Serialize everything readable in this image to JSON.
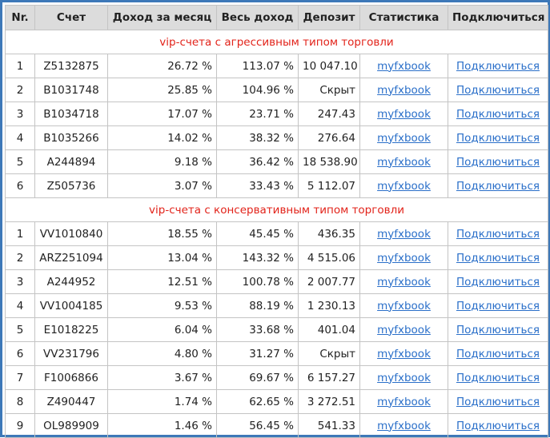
{
  "headers": [
    "Nr.",
    "Счет",
    "Доход за месяц",
    "Весь доход",
    "Депозит",
    "Статистика",
    "Подключиться"
  ],
  "colors": {
    "border": "#3d78b8",
    "header_bg": "#dcdcdc",
    "group_title": "#e2231a",
    "link": "#2a6fc9"
  },
  "groups": [
    {
      "title": "vip-счета с агрессивным типом торговли",
      "rows": [
        {
          "nr": "1",
          "account": "Z5132875",
          "monthly": "26.72 %",
          "total": "113.07 %",
          "deposit": "10 047.10",
          "stats": "myfxbook",
          "connect": "Подключиться"
        },
        {
          "nr": "2",
          "account": "B1031748",
          "monthly": "25.85 %",
          "total": "104.96 %",
          "deposit": "Скрыт",
          "stats": "myfxbook",
          "connect": "Подключиться"
        },
        {
          "nr": "3",
          "account": "B1034718",
          "monthly": "17.07 %",
          "total": "23.71 %",
          "deposit": "247.43",
          "stats": "myfxbook",
          "connect": "Подключиться"
        },
        {
          "nr": "4",
          "account": "B1035266",
          "monthly": "14.02 %",
          "total": "38.32 %",
          "deposit": "276.64",
          "stats": "myfxbook",
          "connect": "Подключиться"
        },
        {
          "nr": "5",
          "account": "A244894",
          "monthly": "9.18 %",
          "total": "36.42 %",
          "deposit": "18 538.90",
          "stats": "myfxbook",
          "connect": "Подключиться"
        },
        {
          "nr": "6",
          "account": "Z505736",
          "monthly": "3.07 %",
          "total": "33.43 %",
          "deposit": "5 112.07",
          "stats": "myfxbook",
          "connect": "Подключиться"
        }
      ]
    },
    {
      "title": "vip-счета с консервативным типом торговли",
      "rows": [
        {
          "nr": "1",
          "account": "VV1010840",
          "monthly": "18.55 %",
          "total": "45.45 %",
          "deposit": "436.35",
          "stats": "myfxbook",
          "connect": "Подключиться"
        },
        {
          "nr": "2",
          "account": "ARZ251094",
          "monthly": "13.04 %",
          "total": "143.32 %",
          "deposit": "4 515.06",
          "stats": "myfxbook",
          "connect": "Подключиться"
        },
        {
          "nr": "3",
          "account": "A244952",
          "monthly": "12.51 %",
          "total": "100.78 %",
          "deposit": "2 007.77",
          "stats": "myfxbook",
          "connect": "Подключиться"
        },
        {
          "nr": "4",
          "account": "VV1004185",
          "monthly": "9.53 %",
          "total": "88.19 %",
          "deposit": "1 230.13",
          "stats": "myfxbook",
          "connect": "Подключиться"
        },
        {
          "nr": "5",
          "account": "E1018225",
          "monthly": "6.04 %",
          "total": "33.68 %",
          "deposit": "401.04",
          "stats": "myfxbook",
          "connect": "Подключиться"
        },
        {
          "nr": "6",
          "account": "VV231796",
          "monthly": "4.80 %",
          "total": "31.27 %",
          "deposit": "Скрыт",
          "stats": "myfxbook",
          "connect": "Подключиться"
        },
        {
          "nr": "7",
          "account": "F1006866",
          "monthly": "3.67 %",
          "total": "69.67 %",
          "deposit": "6 157.27",
          "stats": "myfxbook",
          "connect": "Подключиться"
        },
        {
          "nr": "8",
          "account": "Z490447",
          "monthly": "1.74 %",
          "total": "62.65 %",
          "deposit": "3 272.51",
          "stats": "myfxbook",
          "connect": "Подключиться"
        },
        {
          "nr": "9",
          "account": "OL989909",
          "monthly": "1.46 %",
          "total": "56.45 %",
          "deposit": "541.33",
          "stats": "myfxbook",
          "connect": "Подключиться"
        }
      ]
    }
  ]
}
